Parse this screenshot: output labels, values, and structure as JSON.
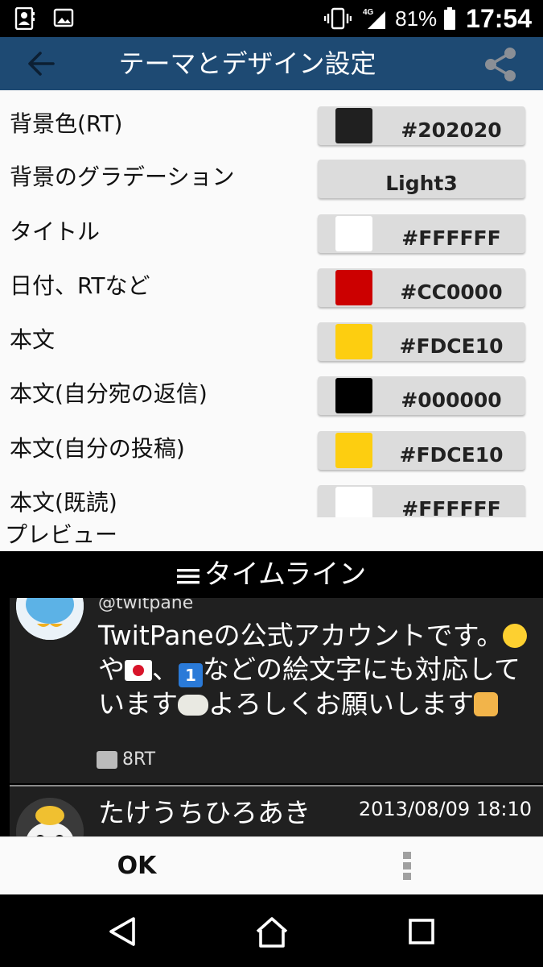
{
  "status_bar": {
    "network": "4G",
    "battery_percent": "81%",
    "time": "17:54",
    "icons": [
      "contacts-icon",
      "image-icon",
      "vibrate-icon",
      "signal-icon",
      "battery-icon"
    ]
  },
  "app_bar": {
    "title": "テーマとデザイン設定",
    "back_icon": "arrow-left-icon",
    "share_icon": "share-icon",
    "background": "#1e4a73"
  },
  "settings": {
    "rows": [
      {
        "label": "背景色(RT)",
        "value": "#202020",
        "swatch": "#202020"
      },
      {
        "label": "背景のグラデーション",
        "value": "Light3",
        "swatch": ""
      },
      {
        "label": "タイトル",
        "value": "#FFFFFF",
        "swatch": "#FFFFFF"
      },
      {
        "label": "日付、RTなど",
        "value": "#CC0000",
        "swatch": "#CC0000"
      },
      {
        "label": "本文",
        "value": "#FDCE10",
        "swatch": "#FDCE10"
      },
      {
        "label": "本文(自分宛の返信)",
        "value": "#000000",
        "swatch": "#000000"
      },
      {
        "label": "本文(自分の投稿)",
        "value": "#FDCE10",
        "swatch": "#FDCE10"
      },
      {
        "label": "本文(既読)",
        "value": "#FFFFFF",
        "swatch": "#FFFFFF"
      }
    ]
  },
  "preview": {
    "label": "プレビュー",
    "header": "タイムライン",
    "tweet1": {
      "handle": "@twitpane",
      "line1": "TwitPaneの公式アカウントです。",
      "line2a": "や",
      "line2b": "、",
      "line2c": "などの絵文字にも対応して",
      "line3a": "います",
      "line3b": "よろしくお願いします",
      "emoji_one": "1",
      "rt": "8RT"
    },
    "tweet2": {
      "name": "たけうちひろあき",
      "date": "2013/08/09 18:10"
    }
  },
  "footer": {
    "ok_label": "OK",
    "more_icon": "more-vertical-icon"
  },
  "nav_bar": {
    "icons": [
      "back-triangle-icon",
      "home-icon",
      "recents-icon"
    ]
  }
}
